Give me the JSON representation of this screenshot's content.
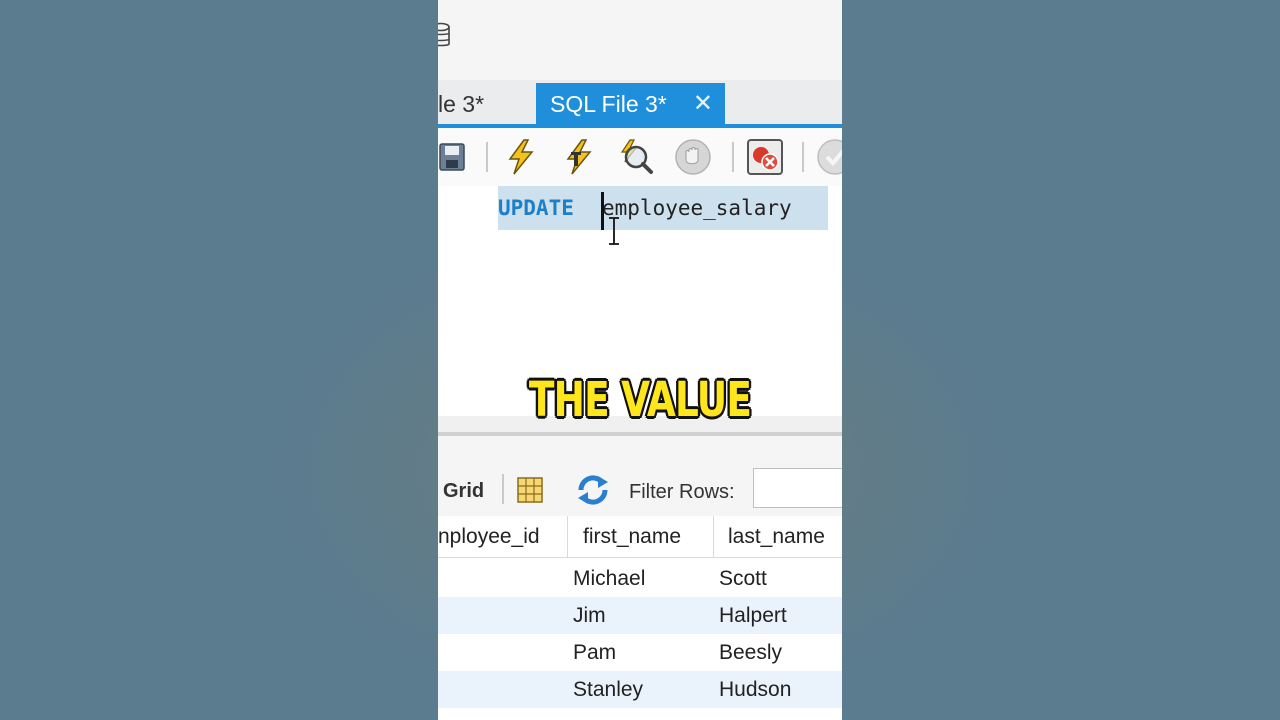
{
  "tabs": {
    "inactive_label": "le 3*",
    "active_label": "SQL File 3*",
    "close_glyph": "✕"
  },
  "editor": {
    "keyword": "UPDATE",
    "identifier": "employee_salary"
  },
  "result_toolbar": {
    "grid_label": "Grid",
    "filter_label": "Filter Rows:",
    "filter_value": ""
  },
  "grid": {
    "columns": [
      "nployee_id",
      "first_name",
      "last_name"
    ],
    "rows": [
      {
        "first_name": "Michael",
        "last_name": "Scott"
      },
      {
        "first_name": "Jim",
        "last_name": "Halpert"
      },
      {
        "first_name": "Pam",
        "last_name": "Beesly"
      },
      {
        "first_name": "Stanley",
        "last_name": "Hudson"
      }
    ]
  },
  "caption": "THE VALUE",
  "icons": {
    "toolbar": [
      "save-icon",
      "execute-icon",
      "execute-current-icon",
      "explain-icon",
      "stop-icon",
      "toggle-stop-on-error-icon",
      "commit-icon"
    ],
    "result": [
      "grid-view-icon",
      "refresh-icon"
    ]
  },
  "colors": {
    "accent": "#1f8fdb",
    "keyword": "#1c7fc8",
    "selection": "#cde0ee",
    "caption": "#ffe51c",
    "backdrop": "#5b7b8f"
  }
}
